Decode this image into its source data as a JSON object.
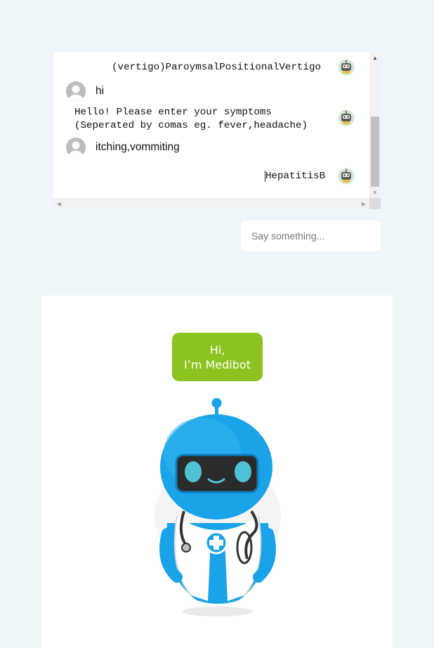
{
  "chat": {
    "messages": [
      {
        "from": "bot",
        "text": "(vertigo)ParoymsalPositionalVertigo",
        "avatar_icon": "robot-avatar-icon"
      },
      {
        "from": "user",
        "text": "hi",
        "avatar_icon": "user-avatar-icon"
      },
      {
        "from": "bot",
        "line1": "Hello! Please enter your symptoms",
        "line2": "(Seperated by comas eg. fever,headache)",
        "avatar_icon": "robot-avatar-icon"
      },
      {
        "from": "user",
        "text": "itching,vommiting",
        "avatar_icon": "user-avatar-icon"
      },
      {
        "from": "bot",
        "text": "HepatitisB",
        "avatar_icon": "robot-avatar-icon"
      }
    ]
  },
  "input": {
    "placeholder": "Say something...",
    "value": ""
  },
  "hero": {
    "greeting_line1": "Hi,",
    "greeting_line2": "I’m Medibot",
    "image_icon": "medibot-robot-illustration"
  },
  "colors": {
    "page_bg": "#eef6f9",
    "bubble_green": "#8cc320",
    "robot_blue": "#1aa3e8"
  }
}
